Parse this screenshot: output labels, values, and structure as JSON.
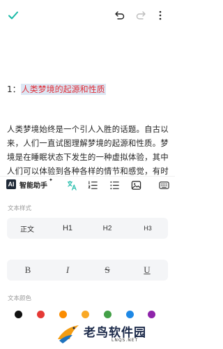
{
  "top_bar": {
    "icons": [
      "check-icon",
      "undo-icon",
      "redo-icon",
      "more-icon"
    ],
    "check_color": "#16b9a6"
  },
  "document": {
    "heading_number": "1：",
    "heading_text": "人类梦境的起源和性质",
    "heading_color": "#e0303a",
    "highlight_color": "#dce6f3",
    "paragraph": "人类梦境始终是一个引人入胜的话题。自古以来，人们一直试图理解梦境的起源和性质。梦境是在睡眠状态下发生的一种虚拟体验，其中人们可以体验到各种各样的情节和感觉，有时甚至超越了现实的限制。有些专"
  },
  "toolbar": {
    "ai_badge": "AI",
    "ai_label": "智能助手",
    "ai_sparkle": "✦",
    "icons": [
      "translate-icon",
      "ordered-list-icon",
      "bullet-list-icon",
      "image-icon",
      "keyboard-icon"
    ]
  },
  "format_panel": {
    "text_style_title": "文本样式",
    "styles": [
      "正文",
      "H1",
      "H2",
      "H3"
    ],
    "selected_style": "正文",
    "decorations": [
      "B",
      "I",
      "S",
      "U"
    ],
    "text_color_title": "文本颜色",
    "colors": [
      "#111111",
      "#e53935",
      "#fb8c00",
      "#f9a825",
      "#43a047",
      "#1e88e5",
      "#3949ab",
      "#8e24aa"
    ]
  },
  "watermark": {
    "text": "老鸟软件园",
    "url": "LNQS.NET"
  }
}
